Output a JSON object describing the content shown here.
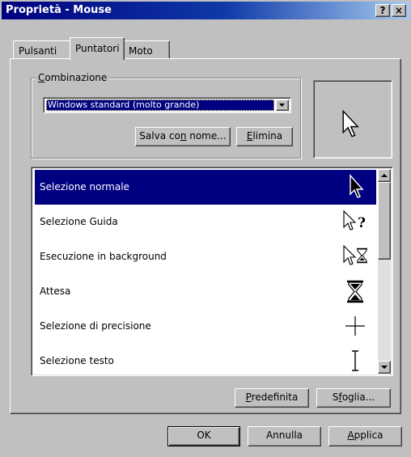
{
  "window": {
    "title": "Proprietà - Mouse",
    "help_label": "?",
    "close_label": "×"
  },
  "tabs": [
    {
      "label": "Pulsanti",
      "active": false
    },
    {
      "label": "Puntatori",
      "active": true
    },
    {
      "label": "Moto",
      "active": false
    }
  ],
  "scheme": {
    "group_label_first": "C",
    "group_label_rest": "ombinazione",
    "selected_value": "Windows standard (molto grande)",
    "save_as": {
      "pre": "Salva co",
      "accel": "n",
      "post": " nome..."
    },
    "delete": {
      "pre": "",
      "accel": "E",
      "post": "limina"
    }
  },
  "preview": {
    "icon": "arrow-cursor-icon"
  },
  "cursor_list": {
    "items": [
      {
        "label": "Selezione normale",
        "icon": "arrow-cursor-icon",
        "selected": true
      },
      {
        "label": "Selezione Guida",
        "icon": "help-cursor-icon",
        "selected": false
      },
      {
        "label": "Esecuzione in background",
        "icon": "working-in-background-cursor-icon",
        "selected": false
      },
      {
        "label": "Attesa",
        "icon": "hourglass-icon",
        "selected": false
      },
      {
        "label": "Selezione di precisione",
        "icon": "crosshair-icon",
        "selected": false
      },
      {
        "label": "Selezione testo",
        "icon": "text-ibeam-icon",
        "selected": false
      }
    ]
  },
  "actions": {
    "default": {
      "pre": "",
      "accel": "P",
      "post": "redefinita"
    },
    "browse": {
      "pre": "S",
      "accel": "f",
      "post": "oglia..."
    }
  },
  "footer": {
    "ok": "OK",
    "cancel": "Annulla",
    "apply": {
      "pre": "",
      "accel": "A",
      "post": "pplica"
    }
  },
  "colors": {
    "selection": "#000080",
    "face": "#c0c0c0",
    "titlebar_start": "#00007f",
    "titlebar_end": "#a6caf0"
  }
}
